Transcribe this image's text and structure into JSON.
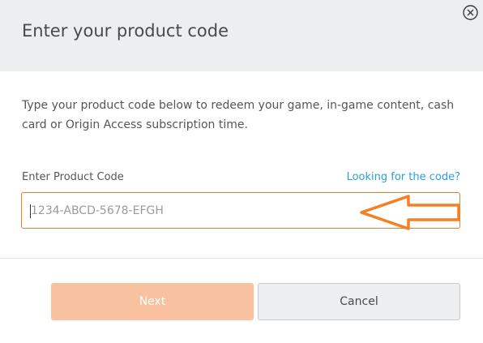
{
  "dialog": {
    "title": "Enter your product code",
    "description": "Type your product code below to redeem your game, in-game content, cash card or Origin Access subscription time.",
    "field_label": "Enter Product Code",
    "help_link": "Looking for the code?",
    "code_input": {
      "value": "",
      "placeholder": "1234-ABCD-5678-EFGH"
    },
    "buttons": {
      "next_label": "Next",
      "cancel_label": "Cancel"
    },
    "icons": {
      "close": "close-circle-icon",
      "annotation": "left-arrow-annotation-icon"
    }
  },
  "colors": {
    "accent": "#f07a2f",
    "next_button_disabled": "#f8c1a0",
    "link": "#2a9fd8",
    "header_bg": "#eceeef"
  }
}
